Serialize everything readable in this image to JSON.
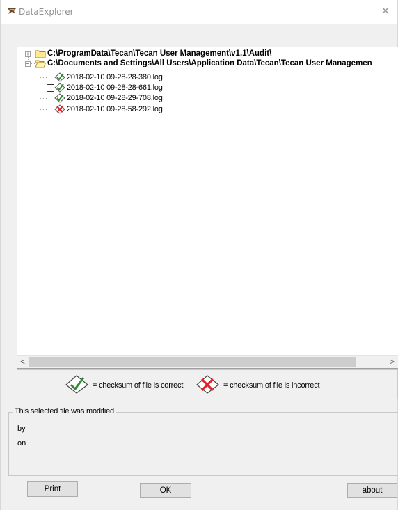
{
  "window": {
    "title": "DataExplorer",
    "close_glyph": "✕"
  },
  "tree": {
    "roots": [
      {
        "label": "C:\\ProgramData\\Tecan\\Tecan User Management\\v1.1\\Audit\\",
        "expander": "+",
        "folder_icon": "folder-closed-icon"
      },
      {
        "label": "C:\\Documents and Settings\\All Users\\Application Data\\Tecan\\Tecan User Managemen",
        "expander": "−",
        "folder_icon": "folder-open-icon"
      }
    ],
    "files": [
      {
        "name": "2018-02-10 09-28-28-380.log",
        "checksum": "correct"
      },
      {
        "name": "2018-02-10 09-28-28-661.log",
        "checksum": "correct"
      },
      {
        "name": "2018-02-10 09-28-29-708.log",
        "checksum": "correct"
      },
      {
        "name": "2018-02-10 09-28-58-292.log",
        "checksum": "incorrect"
      }
    ]
  },
  "scrollbar": {
    "left_arrow": "<",
    "right_arrow": ">"
  },
  "legend": {
    "correct_text": "= checksum of file is correct",
    "incorrect_text": "= checksum of file is incorrect"
  },
  "modified_group": {
    "title": "This selected file was modified",
    "by_label": "by",
    "on_label": "on"
  },
  "buttons": {
    "print": "Print",
    "ok": "OK",
    "about": "about"
  },
  "colors": {
    "check_green": "#2e8b2e",
    "cross_red": "#d8262b",
    "folder_yellow": "#ffe680"
  }
}
